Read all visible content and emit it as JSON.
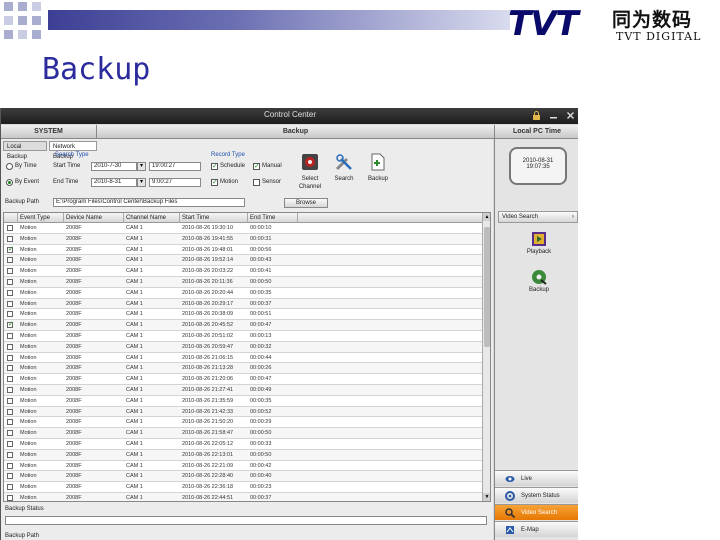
{
  "slide": {
    "title": "Backup",
    "logo": {
      "brand": "TVT",
      "chinese": "同为数码",
      "english": "TVT DIGITAL"
    }
  },
  "colors": {
    "accent": "#f08c1a",
    "title_blue": "#2b2b9e",
    "logo_navy": "#0a0a6a"
  },
  "window": {
    "title": "Control Center",
    "tabs": {
      "system": "SYSTEM",
      "backup": "Backup",
      "local_pc_time": "Local PC Time"
    },
    "controls": [
      "minimize-icon",
      "lock-icon",
      "close-icon"
    ]
  },
  "left": {
    "subtabs": [
      "Local Backup",
      "Network Backup"
    ],
    "search_type_label": "Search Type",
    "record_type_label": "Record Type",
    "by_time_label": "By Time",
    "by_event_label": "By Event",
    "start_time_label": "Start Time",
    "end_time_label": "End Time",
    "start_date": "2010-7-30",
    "start_time": "19:00:27",
    "end_date": "2010-8-31",
    "end_time": "9:00:27",
    "record_types": [
      {
        "label": "Schedule",
        "checked": true
      },
      {
        "label": "Manual",
        "checked": true
      },
      {
        "label": "Motion",
        "checked": true
      },
      {
        "label": "Sensor",
        "checked": false
      }
    ],
    "tools": [
      {
        "label": "Select Channel",
        "icon": "channel-icon"
      },
      {
        "label": "Search",
        "icon": "search-tools-icon"
      },
      {
        "label": "Backup",
        "icon": "backup-file-icon"
      }
    ],
    "backup_path_label": "Backup Path",
    "backup_path_value": "E:\\Program Files\\Control Center\\Backup Files",
    "browse_label": "Browse",
    "columns": [
      "Event Type",
      "Device Name",
      "Channel Name",
      "Start Time",
      "End Time"
    ],
    "rows": [
      {
        "checked": false,
        "event": "Motion",
        "device": "2008F",
        "channel": "CAM 1",
        "start": "2010-08-26 19:30:10",
        "end": "00:00:10"
      },
      {
        "checked": false,
        "event": "Motion",
        "device": "2008F",
        "channel": "CAM 1",
        "start": "2010-08-26 19:41:55",
        "end": "00:00:31"
      },
      {
        "checked": true,
        "event": "Motion",
        "device": "2008F",
        "channel": "CAM 1",
        "start": "2010-08-26 19:48:01",
        "end": "00:00:56"
      },
      {
        "checked": false,
        "event": "Motion",
        "device": "2008F",
        "channel": "CAM 1",
        "start": "2010-08-26 19:52:14",
        "end": "00:00:43"
      },
      {
        "checked": false,
        "event": "Motion",
        "device": "2008F",
        "channel": "CAM 1",
        "start": "2010-08-26 20:03:22",
        "end": "00:00:41"
      },
      {
        "checked": false,
        "event": "Motion",
        "device": "2008F",
        "channel": "CAM 1",
        "start": "2010-08-26 20:11:36",
        "end": "00:00:50"
      },
      {
        "checked": false,
        "event": "Motion",
        "device": "2008F",
        "channel": "CAM 1",
        "start": "2010-08-26 20:20:44",
        "end": "00:00:35"
      },
      {
        "checked": false,
        "event": "Motion",
        "device": "2008F",
        "channel": "CAM 1",
        "start": "2010-08-26 20:29:17",
        "end": "00:00:37"
      },
      {
        "checked": false,
        "event": "Motion",
        "device": "2008F",
        "channel": "CAM 1",
        "start": "2010-08-26 20:38:09",
        "end": "00:00:51"
      },
      {
        "checked": true,
        "event": "Motion",
        "device": "2008F",
        "channel": "CAM 1",
        "start": "2010-08-26 20:45:52",
        "end": "00:00:47"
      },
      {
        "checked": false,
        "event": "Motion",
        "device": "2008F",
        "channel": "CAM 1",
        "start": "2010-08-26 20:51:02",
        "end": "00:00:13"
      },
      {
        "checked": false,
        "event": "Motion",
        "device": "2008F",
        "channel": "CAM 1",
        "start": "2010-08-26 20:59:47",
        "end": "00:00:32"
      },
      {
        "checked": false,
        "event": "Motion",
        "device": "2008F",
        "channel": "CAM 1",
        "start": "2010-08-26 21:06:15",
        "end": "00:00:44"
      },
      {
        "checked": false,
        "event": "Motion",
        "device": "2008F",
        "channel": "CAM 1",
        "start": "2010-08-26 21:13:28",
        "end": "00:00:26"
      },
      {
        "checked": false,
        "event": "Motion",
        "device": "2008F",
        "channel": "CAM 1",
        "start": "2010-08-26 21:20:06",
        "end": "00:00:47"
      },
      {
        "checked": false,
        "event": "Motion",
        "device": "2008F",
        "channel": "CAM 1",
        "start": "2010-08-26 21:27:41",
        "end": "00:00:49"
      },
      {
        "checked": false,
        "event": "Motion",
        "device": "2008F",
        "channel": "CAM 1",
        "start": "2010-08-26 21:35:59",
        "end": "00:00:35"
      },
      {
        "checked": false,
        "event": "Motion",
        "device": "2008F",
        "channel": "CAM 1",
        "start": "2010-08-26 21:42:33",
        "end": "00:00:52"
      },
      {
        "checked": false,
        "event": "Motion",
        "device": "2008F",
        "channel": "CAM 1",
        "start": "2010-08-26 21:50:20",
        "end": "00:00:29"
      },
      {
        "checked": false,
        "event": "Motion",
        "device": "2008F",
        "channel": "CAM 1",
        "start": "2010-08-26 21:58:47",
        "end": "00:00:50"
      },
      {
        "checked": false,
        "event": "Motion",
        "device": "2008F",
        "channel": "CAM 1",
        "start": "2010-08-26 22:05:12",
        "end": "00:00:33"
      },
      {
        "checked": false,
        "event": "Motion",
        "device": "2008F",
        "channel": "CAM 1",
        "start": "2010-08-26 22:13:01",
        "end": "00:00:50"
      },
      {
        "checked": false,
        "event": "Motion",
        "device": "2008F",
        "channel": "CAM 1",
        "start": "2010-08-26 22:21:09",
        "end": "00:00:42"
      },
      {
        "checked": false,
        "event": "Motion",
        "device": "2008F",
        "channel": "CAM 1",
        "start": "2010-08-26 22:28:40",
        "end": "00:00:40"
      },
      {
        "checked": false,
        "event": "Motion",
        "device": "2008F",
        "channel": "CAM 1",
        "start": "2010-08-26 22:36:18",
        "end": "00:00:23"
      },
      {
        "checked": false,
        "event": "Motion",
        "device": "2008F",
        "channel": "CAM 1",
        "start": "2010-08-26 22:44:51",
        "end": "00:00:37"
      }
    ],
    "backup_status_label": "Backup Status",
    "backup_progress": 0,
    "backup_path_footer_label": "Backup Path"
  },
  "right": {
    "date": "2010-08-31",
    "time": "19:07:35",
    "video_search_label": "Video Search",
    "tools": [
      {
        "label": "Playback",
        "icon": "playback-icon"
      },
      {
        "label": "Backup",
        "icon": "backup-disc-icon"
      }
    ],
    "nav": [
      {
        "label": "Live",
        "icon": "live-icon",
        "active": false
      },
      {
        "label": "System Status",
        "icon": "system-status-icon",
        "active": false
      },
      {
        "label": "Video Search",
        "icon": "video-search-nav-icon",
        "active": true
      },
      {
        "label": "E-Map",
        "icon": "emap-icon",
        "active": false
      }
    ]
  }
}
